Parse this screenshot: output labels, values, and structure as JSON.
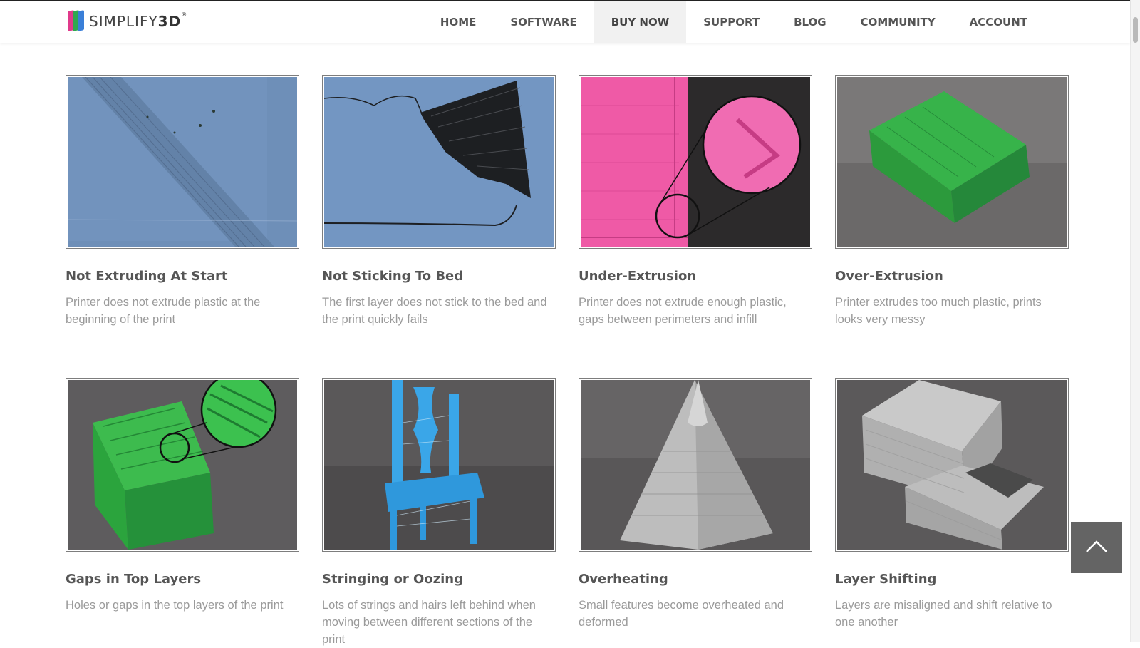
{
  "brand": {
    "name_light": "SIMPLIFY",
    "name_bold": "3D",
    "reg": "®"
  },
  "nav": [
    {
      "label": "HOME"
    },
    {
      "label": "SOFTWARE"
    },
    {
      "label": "BUY NOW",
      "active": true
    },
    {
      "label": "SUPPORT"
    },
    {
      "label": "BLOG"
    },
    {
      "label": "COMMUNITY"
    },
    {
      "label": "ACCOUNT"
    }
  ],
  "cards": [
    {
      "title": "Not Extruding At Start",
      "desc": "Printer does not extrude plastic at the beginning of the print"
    },
    {
      "title": "Not Sticking To Bed",
      "desc": "The first layer does not stick to the bed and the print quickly fails"
    },
    {
      "title": "Under-Extrusion",
      "desc": "Printer does not extrude enough plastic, gaps between perimeters and infill"
    },
    {
      "title": "Over-Extrusion",
      "desc": "Printer extrudes too much plastic, prints looks very messy"
    },
    {
      "title": "Gaps in Top Layers",
      "desc": "Holes or gaps in the top layers of the print"
    },
    {
      "title": "Stringing or Oozing",
      "desc": "Lots of strings and hairs left behind when moving between different sections of the print"
    },
    {
      "title": "Overheating",
      "desc": "Small features become overheated and deformed"
    },
    {
      "title": "Layer Shifting",
      "desc": "Layers are misaligned and shift relative to one another"
    }
  ],
  "icons": {
    "scroll_top": "chevron-up-icon"
  },
  "colors": {
    "logo_bars": [
      "#e03a8b",
      "#2fa84f",
      "#3a7fd8"
    ]
  }
}
